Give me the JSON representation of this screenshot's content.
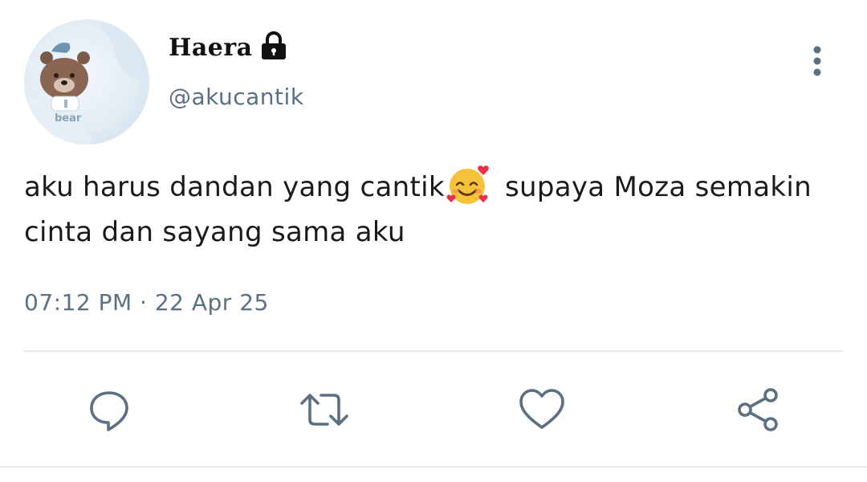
{
  "tweet": {
    "author": {
      "display_name": "Haera",
      "handle": "@akucantik",
      "protected_icon": "lock-icon",
      "avatar_caption": "bear"
    },
    "text_before_emoji": "aku harus dandan yang cantik",
    "emoji": "smiling-face-with-hearts",
    "text_after_emoji": " supaya Moza semakin cinta dan sayang sama aku",
    "timestamp": "07:12 PM · 22 Apr 25"
  },
  "actions": {
    "icons": [
      "reply-icon",
      "retweet-icon",
      "like-icon",
      "share-icon"
    ]
  },
  "colors": {
    "secondary_text": "#5b7083",
    "icon": "#5b7083",
    "divider": "#e6ecf0",
    "primary_text": "#14171a"
  }
}
